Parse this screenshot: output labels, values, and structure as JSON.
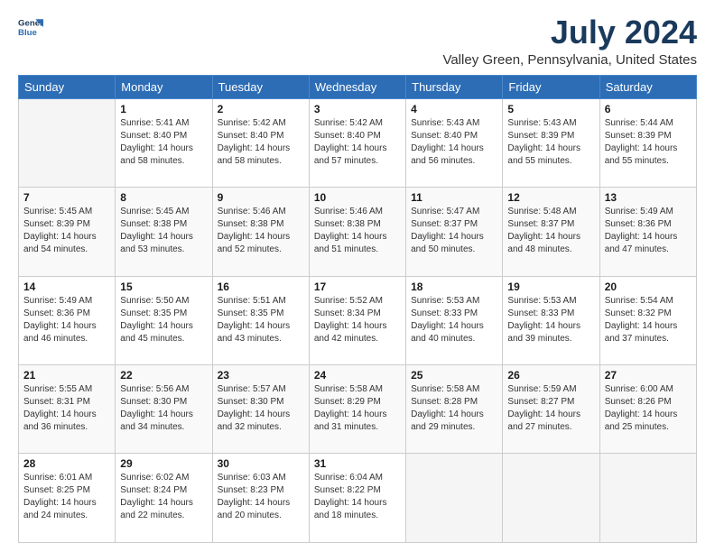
{
  "logo": {
    "line1": "General",
    "line2": "Blue"
  },
  "title": "July 2024",
  "subtitle": "Valley Green, Pennsylvania, United States",
  "weekdays": [
    "Sunday",
    "Monday",
    "Tuesday",
    "Wednesday",
    "Thursday",
    "Friday",
    "Saturday"
  ],
  "weeks": [
    [
      {
        "day": "",
        "info": ""
      },
      {
        "day": "1",
        "info": "Sunrise: 5:41 AM\nSunset: 8:40 PM\nDaylight: 14 hours\nand 58 minutes."
      },
      {
        "day": "2",
        "info": "Sunrise: 5:42 AM\nSunset: 8:40 PM\nDaylight: 14 hours\nand 58 minutes."
      },
      {
        "day": "3",
        "info": "Sunrise: 5:42 AM\nSunset: 8:40 PM\nDaylight: 14 hours\nand 57 minutes."
      },
      {
        "day": "4",
        "info": "Sunrise: 5:43 AM\nSunset: 8:40 PM\nDaylight: 14 hours\nand 56 minutes."
      },
      {
        "day": "5",
        "info": "Sunrise: 5:43 AM\nSunset: 8:39 PM\nDaylight: 14 hours\nand 55 minutes."
      },
      {
        "day": "6",
        "info": "Sunrise: 5:44 AM\nSunset: 8:39 PM\nDaylight: 14 hours\nand 55 minutes."
      }
    ],
    [
      {
        "day": "7",
        "info": "Sunrise: 5:45 AM\nSunset: 8:39 PM\nDaylight: 14 hours\nand 54 minutes."
      },
      {
        "day": "8",
        "info": "Sunrise: 5:45 AM\nSunset: 8:38 PM\nDaylight: 14 hours\nand 53 minutes."
      },
      {
        "day": "9",
        "info": "Sunrise: 5:46 AM\nSunset: 8:38 PM\nDaylight: 14 hours\nand 52 minutes."
      },
      {
        "day": "10",
        "info": "Sunrise: 5:46 AM\nSunset: 8:38 PM\nDaylight: 14 hours\nand 51 minutes."
      },
      {
        "day": "11",
        "info": "Sunrise: 5:47 AM\nSunset: 8:37 PM\nDaylight: 14 hours\nand 50 minutes."
      },
      {
        "day": "12",
        "info": "Sunrise: 5:48 AM\nSunset: 8:37 PM\nDaylight: 14 hours\nand 48 minutes."
      },
      {
        "day": "13",
        "info": "Sunrise: 5:49 AM\nSunset: 8:36 PM\nDaylight: 14 hours\nand 47 minutes."
      }
    ],
    [
      {
        "day": "14",
        "info": "Sunrise: 5:49 AM\nSunset: 8:36 PM\nDaylight: 14 hours\nand 46 minutes."
      },
      {
        "day": "15",
        "info": "Sunrise: 5:50 AM\nSunset: 8:35 PM\nDaylight: 14 hours\nand 45 minutes."
      },
      {
        "day": "16",
        "info": "Sunrise: 5:51 AM\nSunset: 8:35 PM\nDaylight: 14 hours\nand 43 minutes."
      },
      {
        "day": "17",
        "info": "Sunrise: 5:52 AM\nSunset: 8:34 PM\nDaylight: 14 hours\nand 42 minutes."
      },
      {
        "day": "18",
        "info": "Sunrise: 5:53 AM\nSunset: 8:33 PM\nDaylight: 14 hours\nand 40 minutes."
      },
      {
        "day": "19",
        "info": "Sunrise: 5:53 AM\nSunset: 8:33 PM\nDaylight: 14 hours\nand 39 minutes."
      },
      {
        "day": "20",
        "info": "Sunrise: 5:54 AM\nSunset: 8:32 PM\nDaylight: 14 hours\nand 37 minutes."
      }
    ],
    [
      {
        "day": "21",
        "info": "Sunrise: 5:55 AM\nSunset: 8:31 PM\nDaylight: 14 hours\nand 36 minutes."
      },
      {
        "day": "22",
        "info": "Sunrise: 5:56 AM\nSunset: 8:30 PM\nDaylight: 14 hours\nand 34 minutes."
      },
      {
        "day": "23",
        "info": "Sunrise: 5:57 AM\nSunset: 8:30 PM\nDaylight: 14 hours\nand 32 minutes."
      },
      {
        "day": "24",
        "info": "Sunrise: 5:58 AM\nSunset: 8:29 PM\nDaylight: 14 hours\nand 31 minutes."
      },
      {
        "day": "25",
        "info": "Sunrise: 5:58 AM\nSunset: 8:28 PM\nDaylight: 14 hours\nand 29 minutes."
      },
      {
        "day": "26",
        "info": "Sunrise: 5:59 AM\nSunset: 8:27 PM\nDaylight: 14 hours\nand 27 minutes."
      },
      {
        "day": "27",
        "info": "Sunrise: 6:00 AM\nSunset: 8:26 PM\nDaylight: 14 hours\nand 25 minutes."
      }
    ],
    [
      {
        "day": "28",
        "info": "Sunrise: 6:01 AM\nSunset: 8:25 PM\nDaylight: 14 hours\nand 24 minutes."
      },
      {
        "day": "29",
        "info": "Sunrise: 6:02 AM\nSunset: 8:24 PM\nDaylight: 14 hours\nand 22 minutes."
      },
      {
        "day": "30",
        "info": "Sunrise: 6:03 AM\nSunset: 8:23 PM\nDaylight: 14 hours\nand 20 minutes."
      },
      {
        "day": "31",
        "info": "Sunrise: 6:04 AM\nSunset: 8:22 PM\nDaylight: 14 hours\nand 18 minutes."
      },
      {
        "day": "",
        "info": ""
      },
      {
        "day": "",
        "info": ""
      },
      {
        "day": "",
        "info": ""
      }
    ]
  ]
}
